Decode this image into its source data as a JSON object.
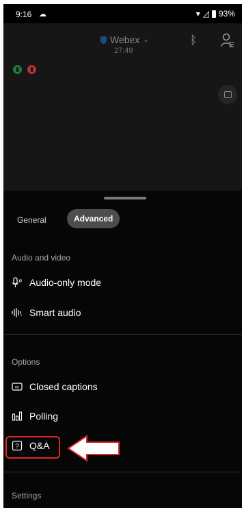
{
  "status_bar": {
    "time": "9:16",
    "battery": "93%"
  },
  "meeting": {
    "app_name": "Webex",
    "duration": "27:49"
  },
  "tabs": [
    {
      "label": "General"
    },
    {
      "label": "Advanced",
      "selected": true
    }
  ],
  "sections": {
    "audio_video": {
      "title": "Audio and video",
      "items": [
        {
          "label": "Audio-only mode"
        },
        {
          "label": "Smart audio"
        }
      ]
    },
    "options": {
      "title": "Options",
      "items": [
        {
          "label": "Closed captions"
        },
        {
          "label": "Polling"
        },
        {
          "label": "Q&A",
          "highlighted": true
        }
      ]
    },
    "settings": {
      "title": "Settings"
    }
  },
  "colors": {
    "highlight": "#e0262a",
    "tab_selected_bg": "#4d4d4d",
    "background": "#000000"
  }
}
